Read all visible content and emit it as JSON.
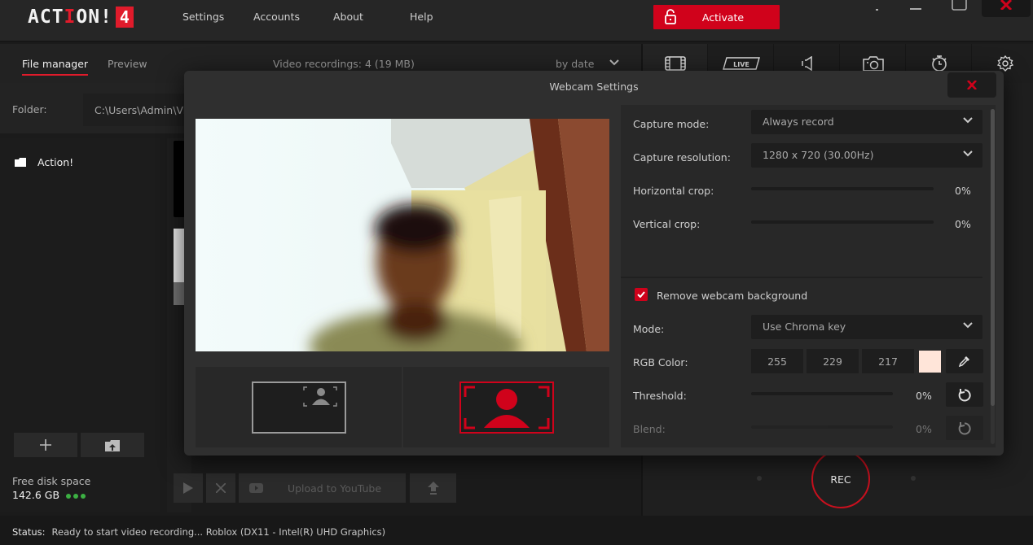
{
  "app": {
    "logo_text_a": "ACT",
    "logo_text_b": "I",
    "logo_text_c": "ON!",
    "logo_version": "4",
    "menu": [
      "Settings",
      "Accounts",
      "About",
      "Help"
    ],
    "activate_label": "Activate",
    "accent_color": "#d0021b"
  },
  "file_manager": {
    "tabs": [
      {
        "label": "File manager",
        "active": true
      },
      {
        "label": "Preview",
        "active": false
      }
    ],
    "recordings_summary": "Video recordings: 4 (19 MB)",
    "sort_label": "by date",
    "folder_label": "Folder:",
    "folder_path": "C:\\Users\\Admin\\Videos\\Action!",
    "tree_items": [
      {
        "label": "Action!",
        "icon": "folder-icon"
      }
    ],
    "disk": {
      "label": "Free disk space",
      "value": "142.6 GB",
      "status_color": "#3cb043"
    },
    "actions": {
      "play": "play-icon",
      "delete": "close-icon",
      "upload_youtube": "Upload to YouTube",
      "upload": "upload-icon"
    }
  },
  "toolbar": {
    "tools": [
      "video-capture",
      "live-stream",
      "audio",
      "screenshot",
      "timer",
      "settings"
    ],
    "live_label": "LIVE"
  },
  "rec_label": "REC",
  "status": {
    "label": "Status:",
    "text": "Ready to start video recording...  Roblox (DX11 - Intel(R) UHD Graphics)"
  },
  "webcam_dialog": {
    "title": "Webcam Settings",
    "modes": [
      {
        "name": "picture-in-picture",
        "selected": false
      },
      {
        "name": "full-frame",
        "selected": true
      }
    ],
    "capture_mode": {
      "label": "Capture mode:",
      "value": "Always record"
    },
    "capture_resolution": {
      "label": "Capture resolution:",
      "value": "1280 x 720 (30.00Hz)"
    },
    "horizontal_crop": {
      "label": "Horizontal crop:",
      "value_percent": 0,
      "display": "0%"
    },
    "vertical_crop": {
      "label": "Vertical crop:",
      "value_percent": 0,
      "display": "0%"
    },
    "remove_background": {
      "label": "Remove webcam background",
      "checked": true
    },
    "bg_mode": {
      "label": "Mode:",
      "value": "Use Chroma key"
    },
    "rgb": {
      "label": "RGB Color:",
      "r": "255",
      "g": "229",
      "b": "217",
      "swatch": "#ffe5d9"
    },
    "threshold": {
      "label": "Threshold:",
      "value_percent": 0,
      "display": "0%"
    },
    "blend": {
      "label": "Blend:",
      "value_percent": 0,
      "display": "0%"
    }
  }
}
